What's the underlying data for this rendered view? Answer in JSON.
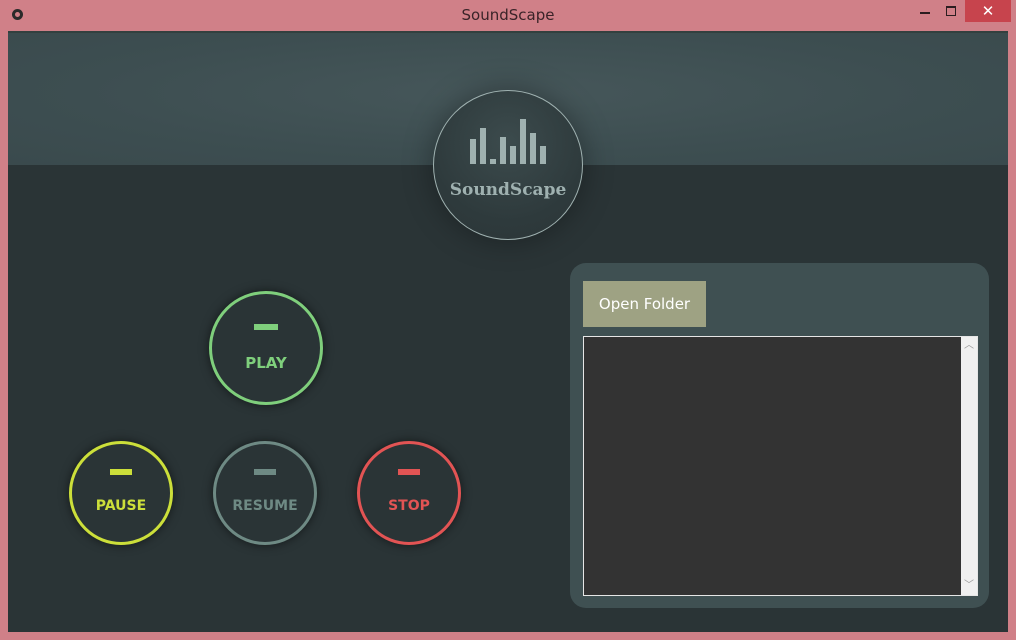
{
  "window": {
    "title": "SoundScape",
    "minimize_glyph": "",
    "close_glyph": "✕",
    "icon": "app-icon"
  },
  "logo": {
    "text": "SoundScape",
    "bar_levels": [
      0.55,
      0.8,
      0.1,
      0.6,
      0.4,
      1.0,
      0.7,
      0.4
    ]
  },
  "controls": {
    "play_label": "PLAY",
    "pause_label": "PAUSE",
    "resume_label": "RESUME",
    "stop_label": "STOP"
  },
  "panel": {
    "open_folder_label": "Open Folder",
    "scroll_up_glyph": "︿",
    "scroll_down_glyph": "﹀"
  },
  "colors": {
    "titlebar": "#d08088",
    "background": "#2a3436",
    "header": "#3d4e51",
    "play": "#7fcf7c",
    "pause": "#ccdf3a",
    "resume": "#6e8a84",
    "stop": "#e25454",
    "folder_button": "#9ea283",
    "listbox": "#333333"
  }
}
